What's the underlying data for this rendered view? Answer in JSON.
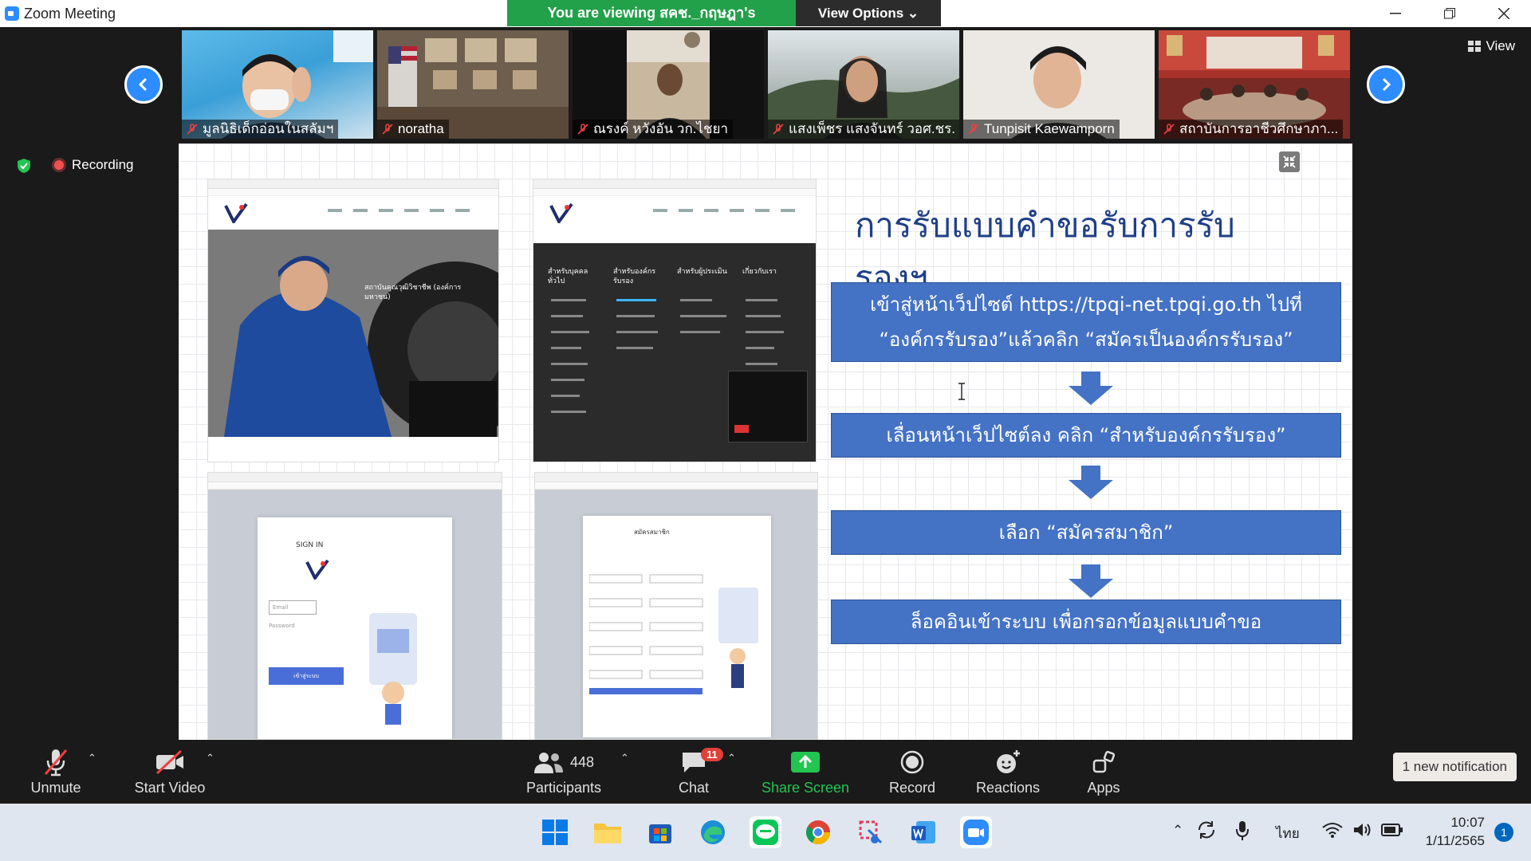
{
  "window": {
    "title": "Zoom Meeting"
  },
  "banner": {
    "message": "You are viewing สคช._กฤษฎา's screen",
    "options_label": "View Options ⌄"
  },
  "participants_strip": [
    {
      "name": "มูลนิธิเด็กอ่อนในสลัมฯ"
    },
    {
      "name": "noratha"
    },
    {
      "name": "ณรงค์ หวังอัน วก.ไชยา"
    },
    {
      "name": "แสงเพ็ชร แสงจันทร์ วอศ.ชร."
    },
    {
      "name": "Tunpisit Kaewamporn"
    },
    {
      "name": "สถาบันการอาชีวศึกษาภา..."
    }
  ],
  "view_button": "View",
  "recording": {
    "label": "Recording"
  },
  "slide": {
    "title": "การรับแบบคำขอรับการรับรองฯ",
    "steps": [
      {
        "line1": "เข้าสู่หน้าเว็ปไซต์ https://tpqi-net.tpqi.go.th ไปที่",
        "line2": "“องค์กรรับรอง”แล้วคลิก “สมัครเป็นองค์กรรับรอง”"
      },
      {
        "line1": "เลื่อนหน้าเว็ปไซต์ลง คลิก “สำหรับองค์กรรับรอง”",
        "line2": ""
      },
      {
        "line1": "เลือก “สมัครสมาชิก”",
        "line2": ""
      },
      {
        "line1": "ล็อคอินเข้าระบบ เพื่อกรอกข้อมูลแบบคำขอ",
        "line2": ""
      }
    ],
    "screenshots": {
      "hero_text": "สถาบันคุณวุฒิวิชาชีพ (องค์การมหาชน)",
      "sign_in": "SIGN IN",
      "email": "Email",
      "password": "Password",
      "sign_in_button": "เข้าสู่ระบบ",
      "form_title": "สมัครสมาชิก",
      "col1": "สำหรับบุคคลทั่วไป",
      "col2": "สำหรับองค์กรรับรอง",
      "col3": "สำหรับผู้ประเมิน",
      "col4": "เกี่ยวกับเรา"
    }
  },
  "toolbar": {
    "unmute": "Unmute",
    "start_video": "Start Video",
    "participants": "Participants",
    "participants_count": "448",
    "chat": "Chat",
    "chat_badge": "11",
    "share_screen": "Share Screen",
    "record": "Record",
    "reactions": "Reactions",
    "apps": "Apps"
  },
  "notification": "1 new notification",
  "taskbar": {
    "language": "ไทย",
    "time": "10:07",
    "date": "1/11/2565",
    "badge": "1"
  },
  "colors": {
    "accent": "#2D8CFF",
    "share_green": "#23c552",
    "slide_box": "#4472c4",
    "slide_title": "#1f3f87"
  }
}
